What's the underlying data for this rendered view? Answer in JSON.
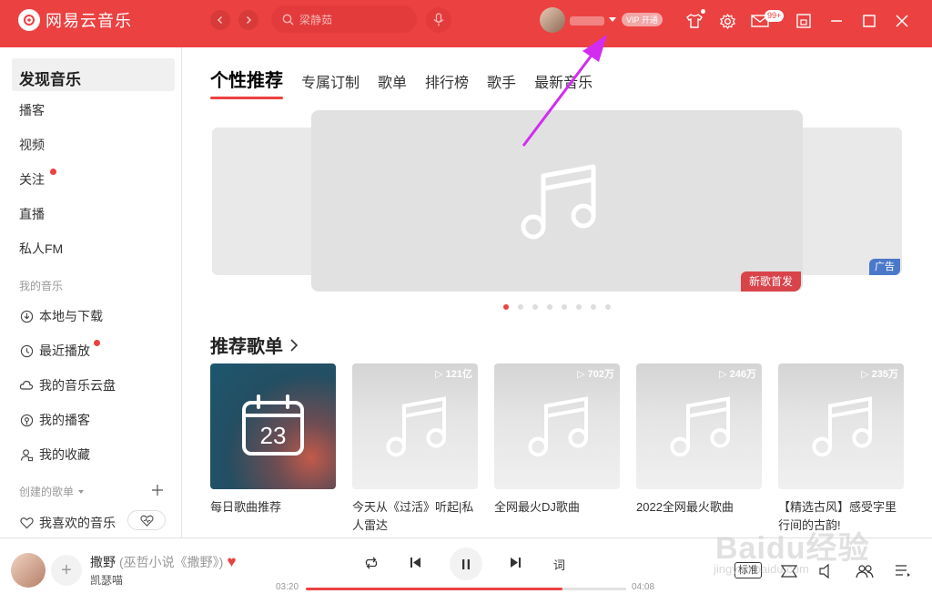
{
  "app": {
    "name": "网易云音乐"
  },
  "search": {
    "placeholder": "梁静茹"
  },
  "header": {
    "vip_label": "VIP 开通",
    "mail_badge": "99+"
  },
  "sidebar": {
    "items": [
      {
        "label": "发现音乐"
      },
      {
        "label": "播客"
      },
      {
        "label": "视频"
      },
      {
        "label": "关注"
      },
      {
        "label": "直播"
      },
      {
        "label": "私人FM"
      }
    ],
    "my_music_title": "我的音乐",
    "my_music": [
      {
        "label": "本地与下载"
      },
      {
        "label": "最近播放"
      },
      {
        "label": "我的音乐云盘"
      },
      {
        "label": "我的播客"
      },
      {
        "label": "我的收藏"
      }
    ],
    "created_title": "创建的歌单",
    "created": [
      {
        "label": "我喜欢的音乐"
      }
    ]
  },
  "tabs": [
    {
      "label": "个性推荐"
    },
    {
      "label": "专属订制"
    },
    {
      "label": "歌单"
    },
    {
      "label": "排行榜"
    },
    {
      "label": "歌手"
    },
    {
      "label": "最新音乐"
    }
  ],
  "banner": {
    "tag": "新歌首发",
    "ad": "广告",
    "page_count": 8,
    "current_page": 1
  },
  "recommend": {
    "title": "推荐歌单",
    "playlists": [
      {
        "title": "每日歌曲推荐",
        "play_count": "",
        "calendar_day": "23"
      },
      {
        "title": "今天从《过活》听起|私人雷达",
        "play_count": "121亿"
      },
      {
        "title": "全网最火DJ歌曲",
        "play_count": "702万"
      },
      {
        "title": "2022全网最火歌曲",
        "play_count": "246万"
      },
      {
        "title": "【精选古风】感受字里行间的古韵!",
        "play_count": "235万"
      }
    ]
  },
  "player": {
    "song": "撒野",
    "song_sub": "(巫哲小说《撒野》)",
    "artist": "凯瑟喵",
    "elapsed": "03:20",
    "duration": "04:08",
    "progress": 0.8,
    "lyrics_label": "词",
    "quality": "标准"
  },
  "watermark": {
    "text": "Baidu经验",
    "sub": "jingyan.baidu.com"
  },
  "colors": {
    "brand": "#ec4141",
    "ad": "#4b79c9",
    "annotation": "#d22cf0"
  }
}
